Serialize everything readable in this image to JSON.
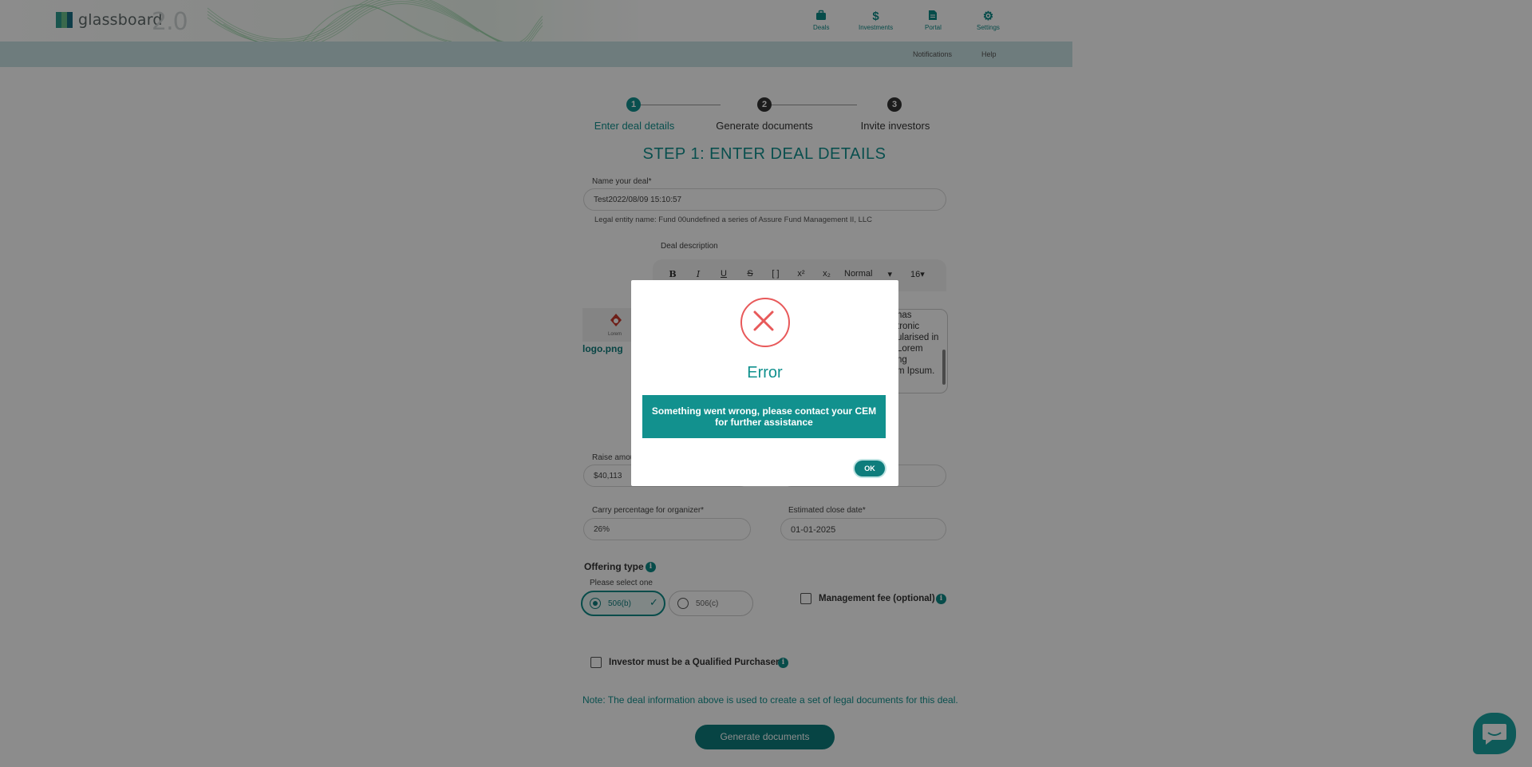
{
  "brand": {
    "name": "glassboard",
    "version": "2.0"
  },
  "nav": {
    "items": [
      {
        "label": "Deals",
        "icon": "briefcase-icon"
      },
      {
        "label": "Investments",
        "icon": "dollar-icon"
      },
      {
        "label": "Portal",
        "icon": "document-icon"
      },
      {
        "label": "Settings",
        "icon": "gear-icon"
      }
    ],
    "sub": [
      {
        "label": "Notifications"
      },
      {
        "label": "Help"
      }
    ]
  },
  "steps": [
    {
      "number": "1",
      "label": "Enter deal details"
    },
    {
      "number": "2",
      "label": "Generate documents"
    },
    {
      "number": "3",
      "label": "Invite investors"
    }
  ],
  "page_title": "STEP 1: ENTER DEAL DETAILS",
  "form": {
    "deal_name": {
      "label": "Name your deal*",
      "value": "Test2022/08/09 15:10:57"
    },
    "legal_entity": "Legal entity name: Fund 00undefined a series of Assure Fund Management II, LLC",
    "description": {
      "label": "Deal description",
      "toolbar": {
        "bold": "B",
        "italic": "I",
        "underline": "U",
        "strike": "S",
        "code": "[ ]",
        "superscript": "x²",
        "subscript": "x₂",
        "format": "Normal",
        "size": "16"
      },
      "visible_lines": [
        "has",
        "tronic",
        "ularised in",
        "Lorem",
        "ng",
        "m Ipsum."
      ]
    },
    "logo": {
      "filename": "logo.png",
      "thumb_text": "Lorem"
    },
    "raise_amount": {
      "label": "Raise amou",
      "value": "$40,113"
    },
    "carry": {
      "label": "Carry percentage for organizer*",
      "value": "26%"
    },
    "close_date": {
      "label": "Estimated close date*",
      "value": "01-01-2025"
    },
    "offering_type": {
      "label": "Offering type",
      "hint": "Please select one",
      "options": [
        "506(b)",
        "506(c)"
      ],
      "selected": "506(b)"
    },
    "management_fee": {
      "label": "Management fee (optional)",
      "checked": false
    },
    "qualified_purchaser": {
      "label": "Investor must be a Qualified Purchaser",
      "checked": false
    },
    "note": "Note: The deal information above is used to create a set of legal documents for this deal.",
    "submit_label": "Generate documents"
  },
  "modal": {
    "title": "Error",
    "message": "Something went wrong, please contact your CEM for further assistance",
    "ok_label": "OK"
  },
  "colors": {
    "accent": "#12918e",
    "error": "#e8595a",
    "header_band": "#c9e2e3"
  }
}
